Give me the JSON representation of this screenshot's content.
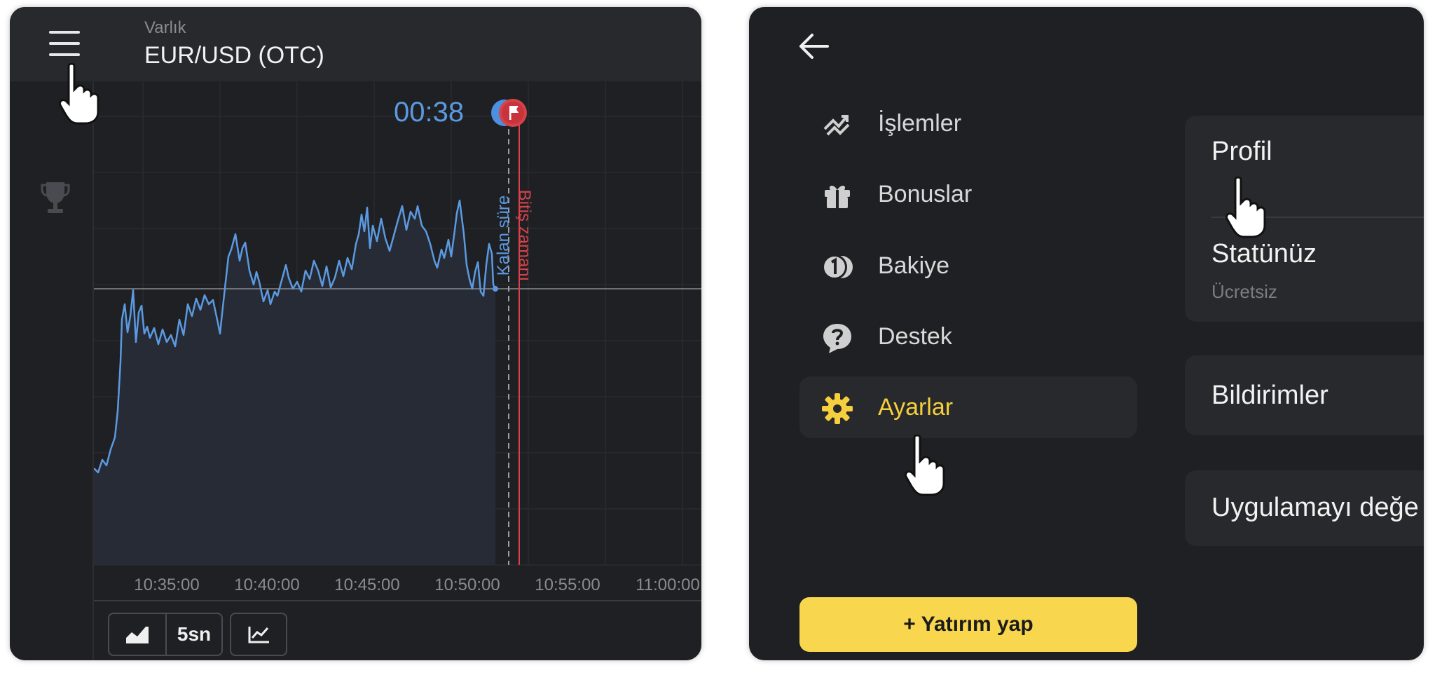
{
  "left_panel": {
    "asset_label": "Varlık",
    "asset_name": "EUR/USD (OTC)",
    "timer": "00:38",
    "remaining_label": "Kalan süre",
    "expiry_label": "Bitiş zamanı",
    "time_labels": [
      "10:35:00",
      "10:40:00",
      "10:45:00",
      "10:50:00",
      "10:55:00",
      "11:00:00"
    ],
    "toolbar": {
      "interval": "5sn"
    },
    "colors": {
      "line": "#5b9ae0",
      "expiry_line": "#d6424a"
    }
  },
  "right_panel": {
    "menu": [
      {
        "label": "İşlemler",
        "icon": "trades-icon"
      },
      {
        "label": "Bonuslar",
        "icon": "gift-icon"
      },
      {
        "label": "Bakiye",
        "icon": "balance-icon"
      },
      {
        "label": "Destek",
        "icon": "support-icon"
      },
      {
        "label": "Ayarlar",
        "icon": "gear-icon",
        "active": true
      }
    ],
    "deposit_button": "+ Yatırım yap",
    "cards": {
      "profile": "Profil",
      "status_title": "Statünüz",
      "status_value": "Ücretsiz",
      "notifications": "Bildirimler",
      "change_app": "Uygulamayı değe"
    },
    "colors": {
      "accent": "#f8d64e",
      "active_text": "#f5cf3d"
    }
  }
}
